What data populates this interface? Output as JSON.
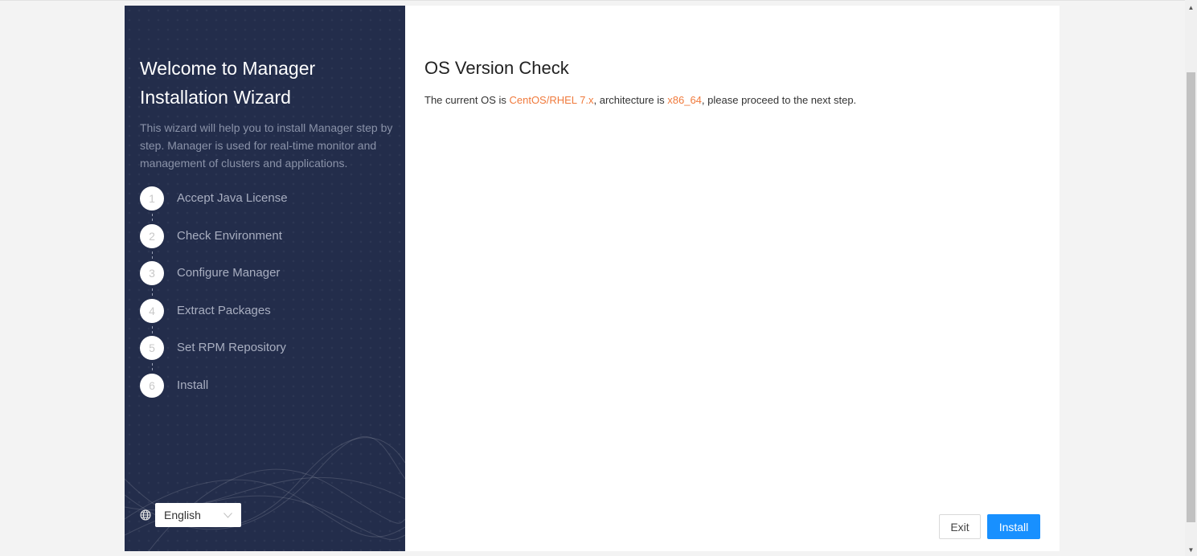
{
  "sidebar": {
    "title": "Welcome to Manager Installation Wizard",
    "description": "This wizard will help you to install Manager step by step. Manager is used for real-time monitor and management of clusters and applications.",
    "steps": [
      {
        "number": "1",
        "label": "Accept Java License"
      },
      {
        "number": "2",
        "label": "Check Environment"
      },
      {
        "number": "3",
        "label": "Configure Manager"
      },
      {
        "number": "4",
        "label": "Extract Packages"
      },
      {
        "number": "5",
        "label": "Set RPM Repository"
      },
      {
        "number": "6",
        "label": "Install"
      }
    ],
    "language": {
      "icon": "globe-icon",
      "selected": "English"
    }
  },
  "main": {
    "title": "OS Version Check",
    "message": {
      "prefix": "The current OS is ",
      "os": "CentOS/RHEL 7.x",
      "middle": ", architecture is ",
      "arch": "x86_64",
      "suffix": ", please proceed to the next step."
    },
    "highlight_color": "#f07a3c"
  },
  "buttons": {
    "exit_label": "Exit",
    "install_label": "Install",
    "primary_color": "#1890ff"
  },
  "scrollbar": {
    "up_glyph": "▲",
    "down_glyph": "▼"
  }
}
